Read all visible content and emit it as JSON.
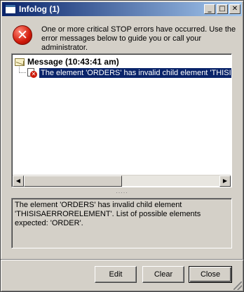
{
  "window": {
    "title": "Infolog (1)",
    "controls": {
      "minimize": "_",
      "maximize": "□",
      "close": "✕"
    }
  },
  "header": {
    "icon": "error-stop-icon",
    "message": "One or more critical STOP errors have occurred. Use the error messages below to guide you or call your administrator."
  },
  "tree": {
    "group_label": "Message (10:43:41 am)",
    "group_icon": "envelope-icon",
    "item_icon": "error-document-icon",
    "item_text": "The element 'ORDERS' has invalid child element 'THISISAERRORELEMENT'. List of possible elements expected: 'ORDER'."
  },
  "splitter": {
    "grip": "....."
  },
  "scrollbar": {
    "left_arrow": "◀",
    "right_arrow": "▶"
  },
  "detail": {
    "text": "The element 'ORDERS' has invalid child element 'THISISAERRORELEMENT'. List of possible elements expected: 'ORDER'."
  },
  "buttons": {
    "edit": "Edit",
    "clear": "Clear",
    "close": "Close"
  },
  "colors": {
    "titlebar": "#0a246a",
    "selection": "#0a246a",
    "error": "#cc1a0a",
    "face": "#d4d0c8"
  }
}
